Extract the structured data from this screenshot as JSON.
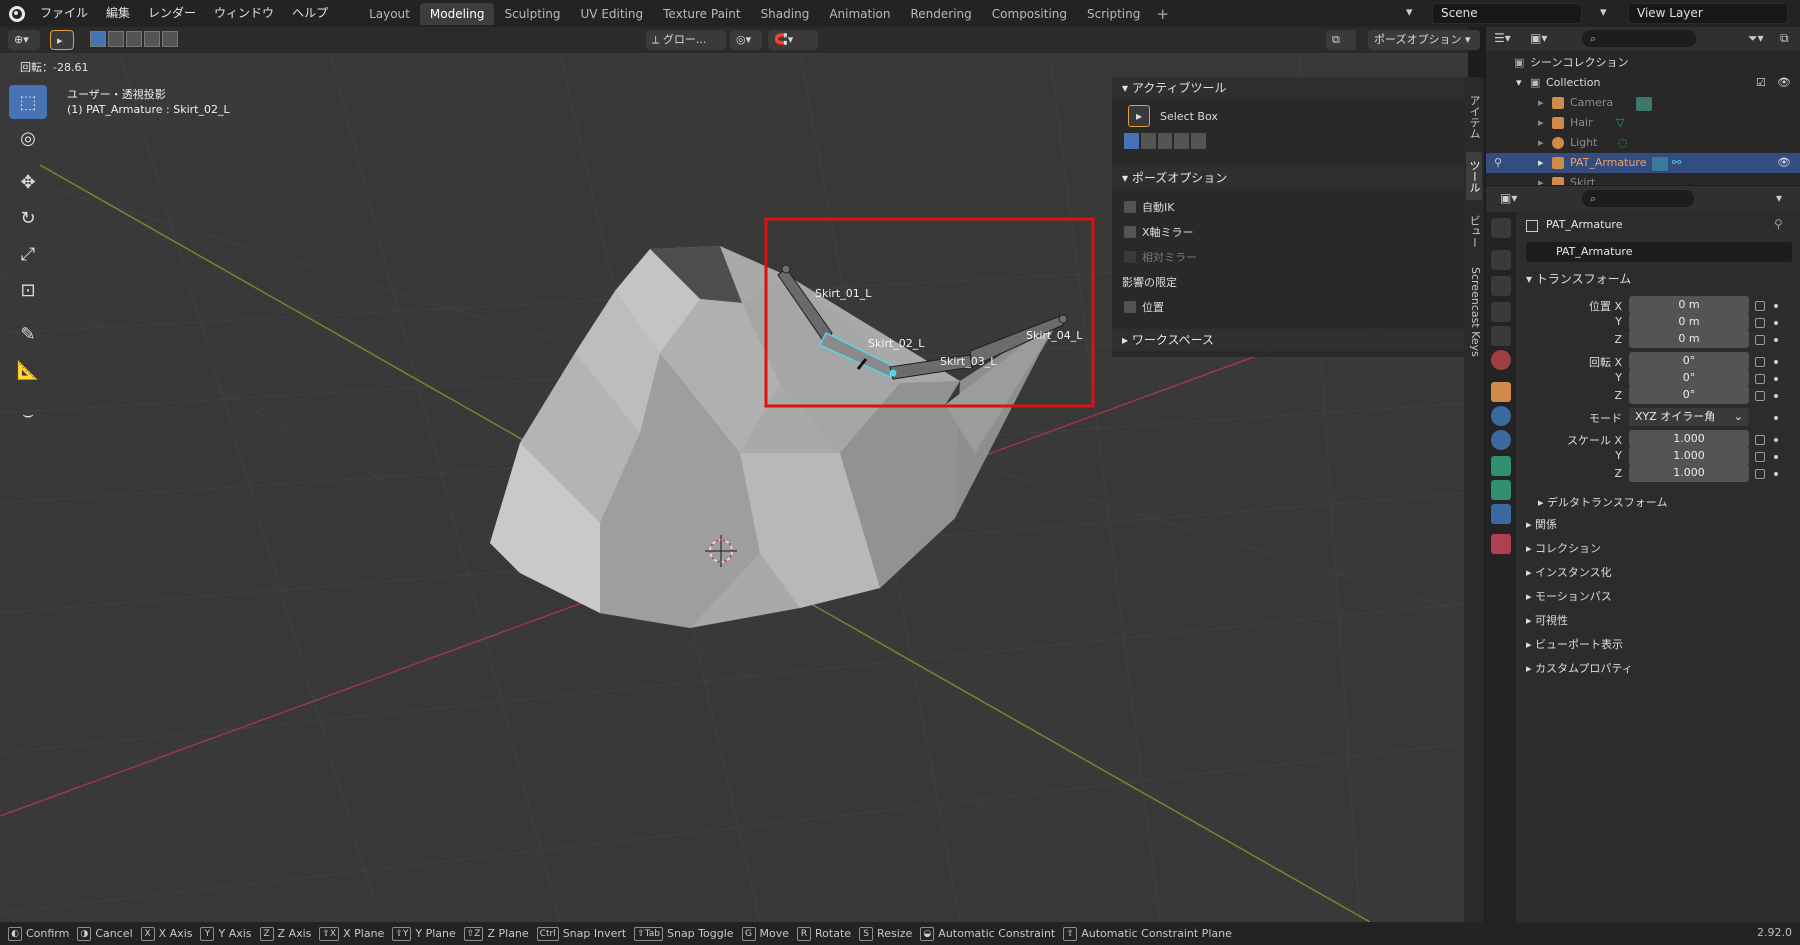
{
  "topbar": {
    "menus": [
      "ファイル",
      "編集",
      "レンダー",
      "ウィンドウ",
      "ヘルプ"
    ],
    "workspaces": [
      "Layout",
      "Modeling",
      "Sculpting",
      "UV Editing",
      "Texture Paint",
      "Shading",
      "Animation",
      "Rendering",
      "Compositing",
      "Scripting"
    ],
    "active_workspace": "Modeling",
    "add_tab": "+",
    "scene": "Scene",
    "view_layer": "View Layer"
  },
  "viewport_header": {
    "orientation": "グロー...",
    "pose_options": "ポーズオプション"
  },
  "viewport": {
    "rotation_status": "回転：-28.61",
    "view_name": "ユーザー・透視投影",
    "active_object": "(1) PAT_Armature : Skirt_02_L",
    "bones": [
      "Skirt_01_L",
      "Skirt_02_L",
      "Skirt_03_L",
      "Skirt_04_L"
    ]
  },
  "npanel": {
    "active_tool_title": "アクティブツール",
    "active_tool_name": "Select Box",
    "pose_options_title": "ポーズオプション",
    "auto_ik": "自動IK",
    "x_mirror": "X軸ミラー",
    "relative_mirror": "相対ミラー",
    "limit_header": "影響の限定",
    "location": "位置",
    "workspace_title": "ワークスペース",
    "tabs": [
      "アイテム",
      "ツール",
      "ビュー",
      "Screencast Keys"
    ]
  },
  "outliner": {
    "scene_collection": "シーンコレクション",
    "collection": "Collection",
    "items": [
      "Camera",
      "Hair",
      "Light",
      "PAT_Armature",
      "Skirt"
    ]
  },
  "properties": {
    "object_name": "PAT_Armature",
    "object_field": "PAT_Armature",
    "transform_title": "トランスフォーム",
    "location_label": "位置 X",
    "rotation_label": "回転 X",
    "scale_label": "スケール X",
    "axis_y": "Y",
    "axis_z": "Z",
    "loc": [
      "0 m",
      "0 m",
      "0 m"
    ],
    "rot": [
      "0°",
      "0°",
      "0°"
    ],
    "mode_label": "モード",
    "mode_value": "XYZ オイラー角",
    "scale": [
      "1.000",
      "1.000",
      "1.000"
    ],
    "delta": "デルタトランスフォーム",
    "sections": [
      "関係",
      "コレクション",
      "インスタンス化",
      "モーションパス",
      "可視性",
      "ビューポート表示",
      "カスタムプロパティ"
    ]
  },
  "statusbar": {
    "items": [
      {
        "key": "",
        "label": "Confirm"
      },
      {
        "key": "",
        "label": "Cancel"
      },
      {
        "key": "X",
        "label": "X Axis"
      },
      {
        "key": "Y",
        "label": "Y Axis"
      },
      {
        "key": "Z",
        "label": "Z Axis"
      },
      {
        "key": "⇧X",
        "label": "X Plane"
      },
      {
        "key": "⇧Y",
        "label": "Y Plane"
      },
      {
        "key": "⇧Z",
        "label": "Z Plane"
      },
      {
        "key": "Ctrl",
        "label": "Snap Invert"
      },
      {
        "key": "⇧Tab",
        "label": "Snap Toggle"
      },
      {
        "key": "G",
        "label": "Move"
      },
      {
        "key": "R",
        "label": "Rotate"
      },
      {
        "key": "S",
        "label": "Resize"
      },
      {
        "key": "",
        "label": "Automatic Constraint"
      },
      {
        "key": "⇧",
        "label": "Automatic Constraint Plane"
      }
    ],
    "version": "2.92.0"
  }
}
